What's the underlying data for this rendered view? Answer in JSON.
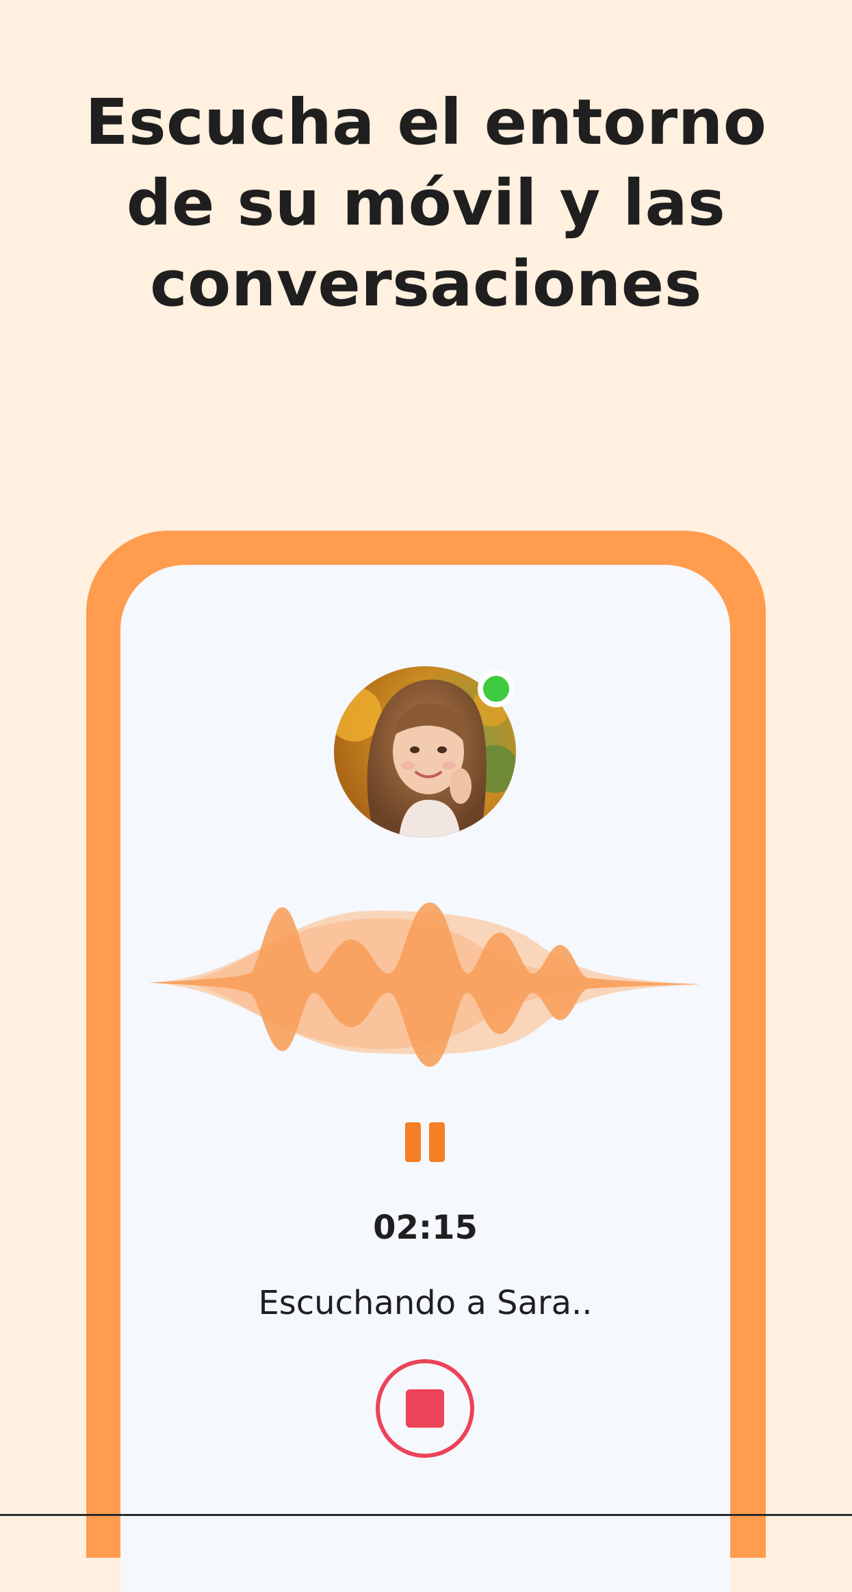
{
  "headline": {
    "line1": "Escucha el entorno",
    "line2": "de su móvil y las",
    "line3": "conversaciones"
  },
  "listening": {
    "avatar": "child-photo",
    "online_status": "online",
    "timer": "02:15",
    "status_text": "Escuchando a Sara..",
    "pause_icon": "pause-icon",
    "stop_icon": "stop-icon"
  },
  "colors": {
    "background": "#FFF0DF",
    "phone_frame": "#FF9C4E",
    "screen": "#F5F8FD",
    "accent_orange": "#F57F25",
    "stop_red": "#EC4358",
    "online_green": "#3FCB3F",
    "text": "#1F1F1F"
  }
}
